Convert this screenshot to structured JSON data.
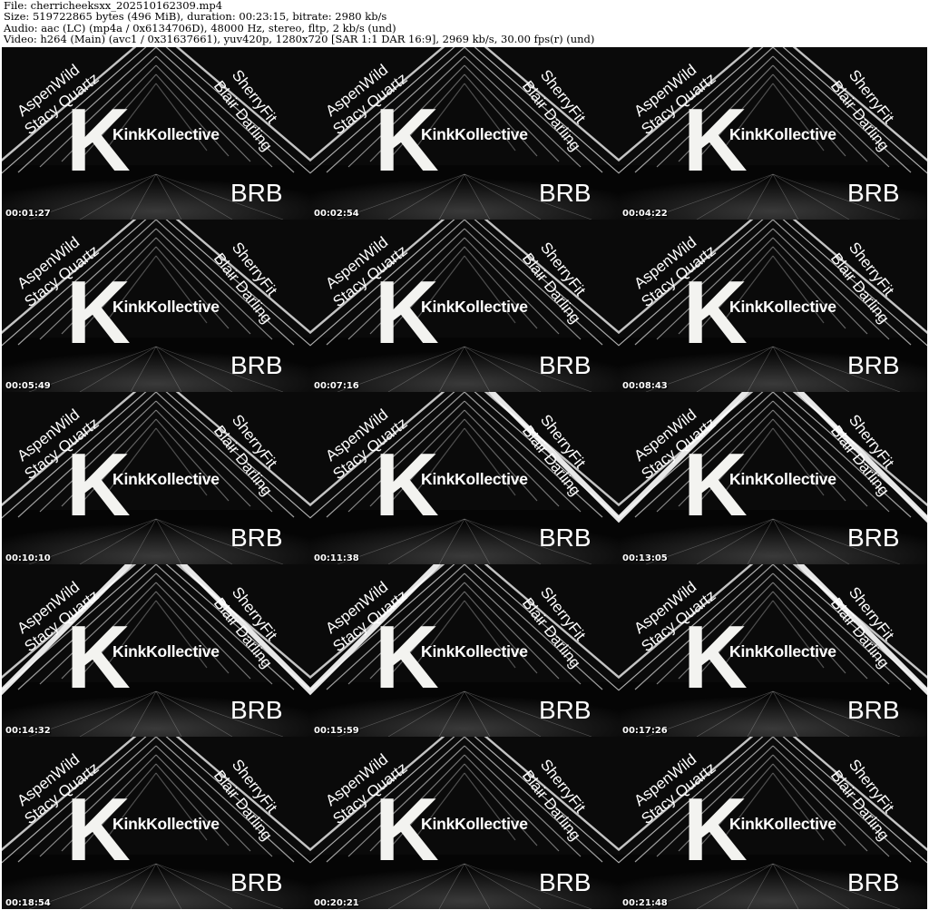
{
  "header": {
    "line1": "File: cherricheeksxx_202510162309.mp4",
    "line2": "Size: 519722865 bytes (496 MiB), duration: 00:23:15, bitrate: 2980 kb/s",
    "line3": "Audio: aac (LC) (mp4a / 0x6134706D), 48000 Hz, stereo, fltp, 2 kb/s (und)",
    "line4": "Video: h264 (Main) (avc1 / 0x31637661), yuv420p, 1280x720 [SAR 1:1 DAR 16:9], 2969 kb/s, 30.00 fps(r) (und)"
  },
  "overlay": {
    "name1": "AspenWild",
    "name2": "Stacy Quartz",
    "name3": "SherryFit",
    "name4": "Blair Darling",
    "logo_letter": "K",
    "logo_name": "KinkKollective",
    "status": "BRB"
  },
  "colors": {
    "background": "#ffffff",
    "frame": "#0b0b0b",
    "text": "#ffffff"
  },
  "thumbnails": [
    {
      "timestamp": "00:01:27",
      "flare": "none"
    },
    {
      "timestamp": "00:02:54",
      "flare": "none"
    },
    {
      "timestamp": "00:04:22",
      "flare": "none"
    },
    {
      "timestamp": "00:05:49",
      "flare": "none"
    },
    {
      "timestamp": "00:07:16",
      "flare": "none"
    },
    {
      "timestamp": "00:08:43",
      "flare": "none"
    },
    {
      "timestamp": "00:10:10",
      "flare": "none"
    },
    {
      "timestamp": "00:11:38",
      "flare": "right"
    },
    {
      "timestamp": "00:13:05",
      "flare": "both"
    },
    {
      "timestamp": "00:14:32",
      "flare": "both"
    },
    {
      "timestamp": "00:15:59",
      "flare": "left"
    },
    {
      "timestamp": "00:17:26",
      "flare": "right"
    },
    {
      "timestamp": "00:18:54",
      "flare": "none"
    },
    {
      "timestamp": "00:20:21",
      "flare": "none"
    },
    {
      "timestamp": "00:21:48",
      "flare": "none"
    }
  ]
}
